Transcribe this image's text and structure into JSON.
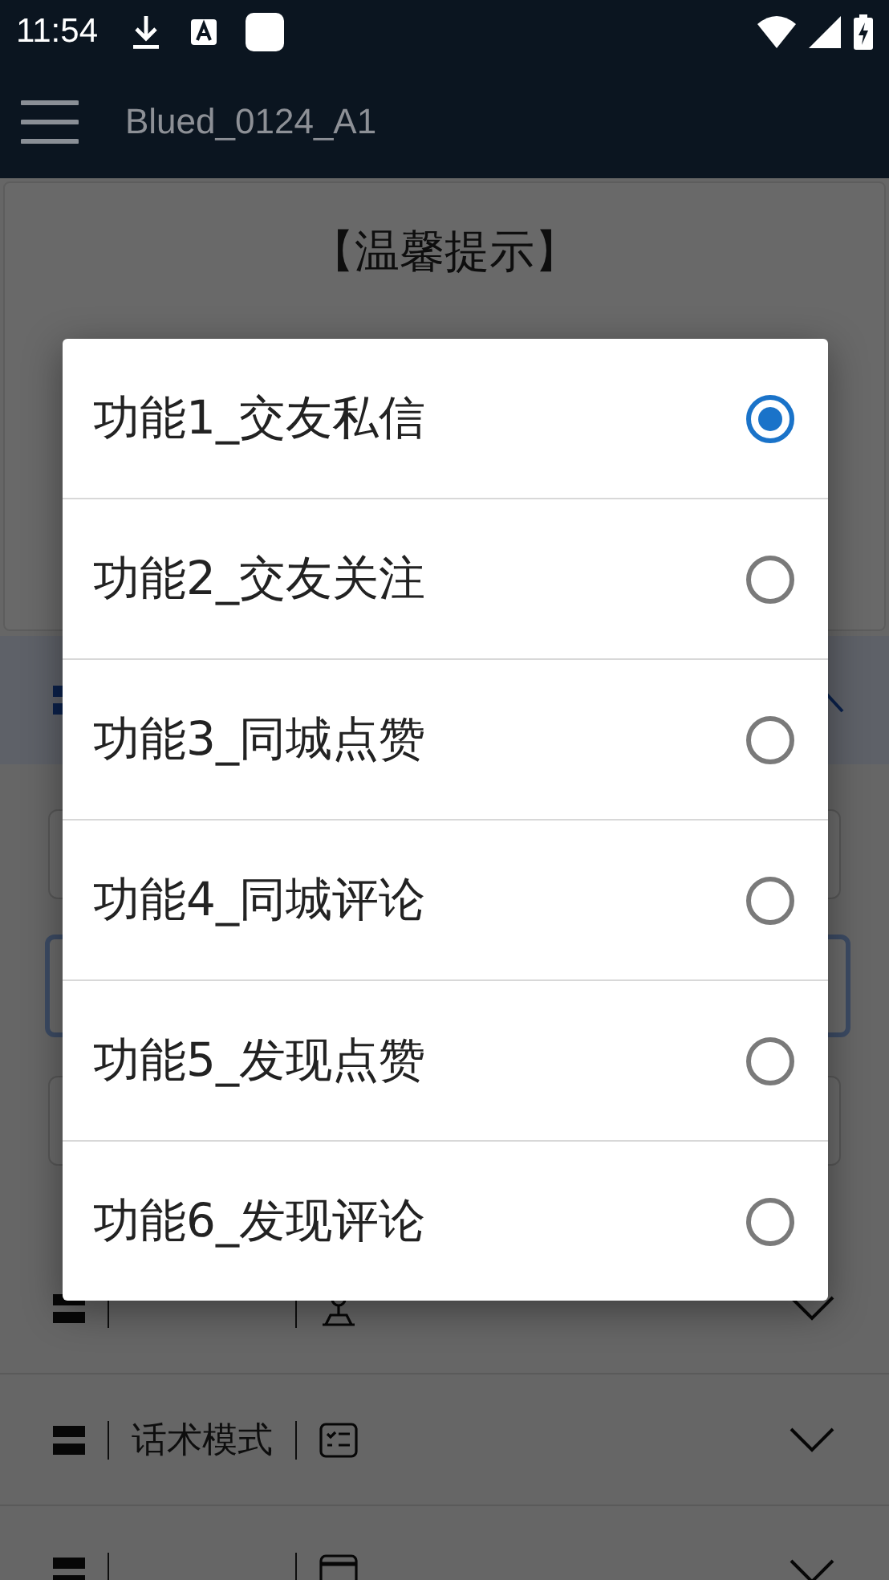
{
  "status_bar": {
    "time": "11:54"
  },
  "app_bar": {
    "title": "Blued_0124_A1"
  },
  "notice": {
    "title": "【温馨提示】"
  },
  "open_section": {
    "expanded": true
  },
  "sections": [
    {
      "expanded": false
    },
    {
      "label": "话术模式",
      "expanded": false
    },
    {
      "expanded": false
    }
  ],
  "dialog": {
    "options": [
      {
        "label": "功能1_交友私信",
        "selected": true
      },
      {
        "label": "功能2_交友关注",
        "selected": false
      },
      {
        "label": "功能3_同城点赞",
        "selected": false
      },
      {
        "label": "功能4_同城评论",
        "selected": false
      },
      {
        "label": "功能5_发现点赞",
        "selected": false
      },
      {
        "label": "功能6_发现评论",
        "selected": false
      }
    ]
  }
}
